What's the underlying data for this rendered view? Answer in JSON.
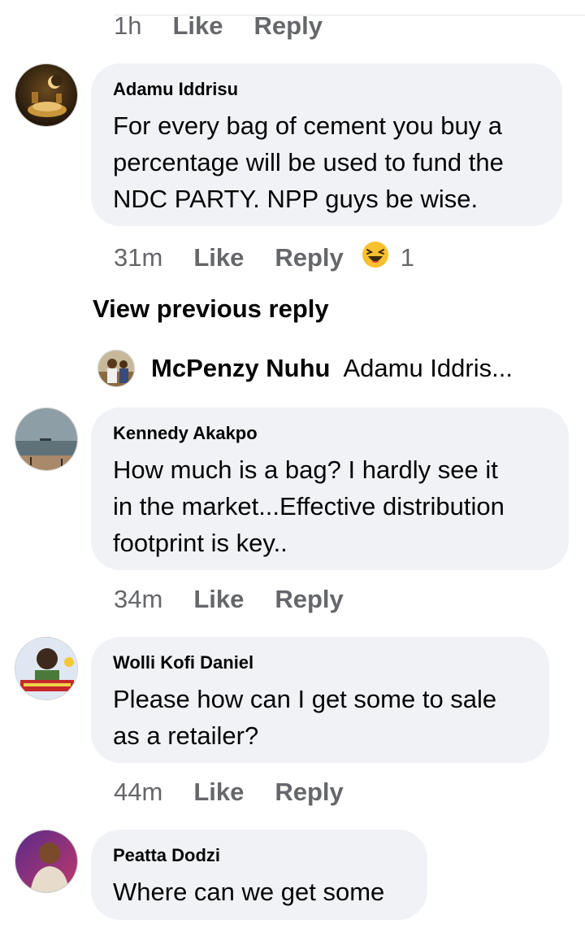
{
  "top_actions": {
    "time": "1h",
    "like": "Like",
    "reply": "Reply"
  },
  "comments": [
    {
      "author": "Adamu Iddrisu",
      "lines": [
        "For every bag of cement you buy a",
        "percentage will be used to fund the",
        "NDC PARTY. NPP guys be wise."
      ],
      "time": "31m",
      "like": "Like",
      "reply": "Reply",
      "reaction_icon": "laughing-face-icon",
      "reaction_count": "1"
    },
    {
      "author": "Kennedy Akakpo",
      "lines": [
        "How much  is a bag? I hardly see it",
        "in the market...Effective distribution",
        "footprint is key.."
      ],
      "time": "34m",
      "like": "Like",
      "reply": "Reply"
    },
    {
      "author": "Wolli Kofi Daniel",
      "lines": [
        "Please how can I get some to sale",
        "as a retailer?"
      ],
      "time": "44m",
      "like": "Like",
      "reply": "Reply"
    },
    {
      "author": "Peatta Dodzi",
      "lines": [
        "Where can we get some"
      ]
    }
  ],
  "view_previous_reply": "View previous reply",
  "reply_preview": {
    "author": "McPenzy Nuhu",
    "text": "Adamu Iddris..."
  },
  "colors": {
    "bubble": "#f0f2f5",
    "meta_text": "#65676b",
    "main_text": "#050505"
  }
}
